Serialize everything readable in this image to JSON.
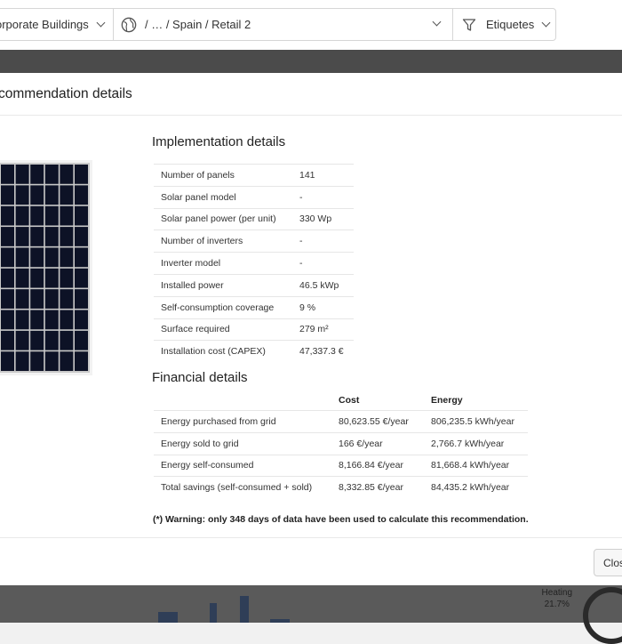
{
  "topbar": {
    "filter_building": "orporate Buildings",
    "filter_path": "/ … / Spain / Retail 2",
    "filter_tags": "Etiquetes"
  },
  "modal": {
    "title": "commendation details",
    "implementation": {
      "title": "Implementation details",
      "rows": [
        {
          "label": "Number of panels",
          "value": "141"
        },
        {
          "label": "Solar panel model",
          "value": "-"
        },
        {
          "label": "Solar panel power (per unit)",
          "value": "330 Wp"
        },
        {
          "label": "Number of inverters",
          "value": "-"
        },
        {
          "label": "Inverter model",
          "value": "-"
        },
        {
          "label": "Installed power",
          "value": "46.5 kWp"
        },
        {
          "label": "Self-consumption coverage",
          "value": "9 %"
        },
        {
          "label": "Surface required",
          "value": "279 m²"
        },
        {
          "label": "Installation cost (CAPEX)",
          "value": "47,337.3 €"
        }
      ]
    },
    "financial": {
      "title": "Financial details",
      "headers": {
        "cost": "Cost",
        "energy": "Energy"
      },
      "rows": [
        {
          "label": "Energy purchased from grid",
          "cost": "80,623.55 €/year",
          "energy": "806,235.5 kWh/year"
        },
        {
          "label": "Energy sold to grid",
          "cost": "166 €/year",
          "energy": "2,766.7 kWh/year"
        },
        {
          "label": "Energy self-consumed",
          "cost": "8,166.84 €/year",
          "energy": "81,668.4 kWh/year"
        },
        {
          "label": "Total savings (self-consumed + sold)",
          "cost": "8,332.85 €/year",
          "energy": "84,435.2 kWh/year"
        }
      ]
    },
    "warning": "(*) Warning: only 348 days of data have been used to calculate this recommendation.",
    "close_label": "Close"
  },
  "background": {
    "heating_label": "Heating",
    "heating_value": "21.7%"
  },
  "colors": {
    "panel_cells": "#0d1226",
    "dark_band": "#4b4b4b",
    "chart_bar": "#2f3e57"
  },
  "icons": {
    "globe": "globe-icon",
    "filter": "filter-icon",
    "chevron": "chevron-down-icon"
  }
}
